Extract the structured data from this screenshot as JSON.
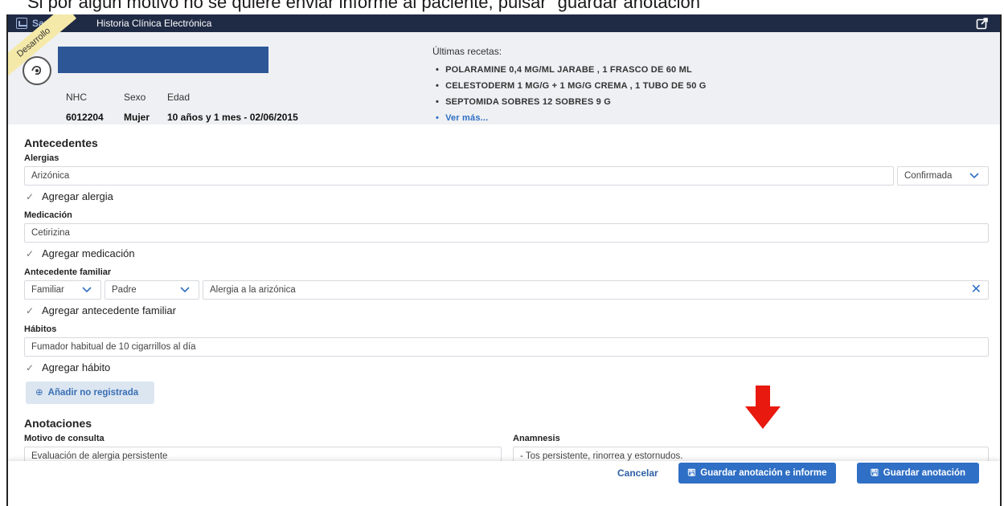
{
  "caption": "Si por algún motivo no se quiere enviar informe al paciente, pulsar \"guardar anotación\"",
  "app": {
    "name": "Sanitas",
    "title": "Historia Clínica Electrónica",
    "env_ribbon": "Desarrollo",
    "exit_icon": "exit-icon"
  },
  "patient": {
    "labels": {
      "nhc": "NHC",
      "sex": "Sexo",
      "age": "Edad"
    },
    "nhc": "6012204",
    "sex": "Mujer",
    "age": "10 años y 1 mes - 02/06/2015"
  },
  "recipes": {
    "title": "Últimas recetas:",
    "items": [
      "POLARAMINE 0,4 MG/ML JARABE , 1 FRASCO DE 60 ML",
      "CELESTODERM 1 MG/G + 1 MG/G CREMA , 1 TUBO DE 50 G",
      "SEPTOMIDA SOBRES 12 SOBRES 9 G"
    ],
    "more": "Ver más..."
  },
  "antecedentes": {
    "title": "Antecedentes",
    "alergias": {
      "label": "Alergias",
      "value": "Arizónica",
      "status": "Confirmada",
      "check": "Agregar alergia"
    },
    "medicacion": {
      "label": "Medicación",
      "value": "Cetirizina",
      "check": "Agregar medicación"
    },
    "familiar": {
      "label": "Antecedente familiar",
      "type": "Familiar",
      "relation": "Padre",
      "value": "Alergia a la arizónica",
      "check": "Agregar antecedente familiar"
    },
    "habitos": {
      "label": "Hábitos",
      "value": "Fumador habitual de 10 cigarrillos al día",
      "check": "Agregar hábito"
    },
    "add_unregistered": "Añadir no registrada"
  },
  "anotaciones": {
    "title": "Anotaciones",
    "motivo_label": "Motivo de consulta",
    "motivo_value": "Evaluación de alergia persistente",
    "anamnesis_label": "Anamnesis",
    "anamnesis_value": "- Tos persistente, rinorrea y estornudos."
  },
  "footer": {
    "cancel": "Cancelar",
    "save_report": "Guardar anotación e informe",
    "save": "Guardar anotación"
  },
  "colors": {
    "accent": "#2f6fc5",
    "topbar": "#1f2a44",
    "arrow": "#e8190f"
  }
}
